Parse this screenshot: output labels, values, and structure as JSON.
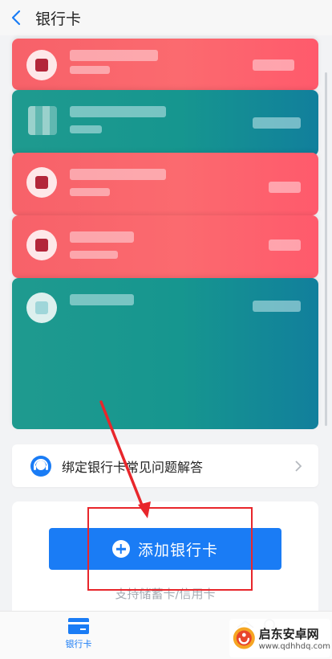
{
  "header": {
    "title": "银行卡"
  },
  "faq": {
    "label": "绑定银行卡常见问题解答"
  },
  "add_card": {
    "button_label": "添加银行卡",
    "support_text": "支持储蓄卡/信用卡"
  },
  "tabbar": {
    "cards_label": "银行卡"
  },
  "watermark": {
    "name": "启东安卓网",
    "url": "www.qdhhdq.com"
  },
  "cards": [
    {
      "color": "red"
    },
    {
      "color": "teal"
    },
    {
      "color": "red"
    },
    {
      "color": "red"
    },
    {
      "color": "teal"
    }
  ],
  "colors": {
    "primary_button": "#1a7cf5",
    "card_red": "#fb6a6f",
    "card_teal": "#16968f",
    "annotation": "#e8262b"
  }
}
